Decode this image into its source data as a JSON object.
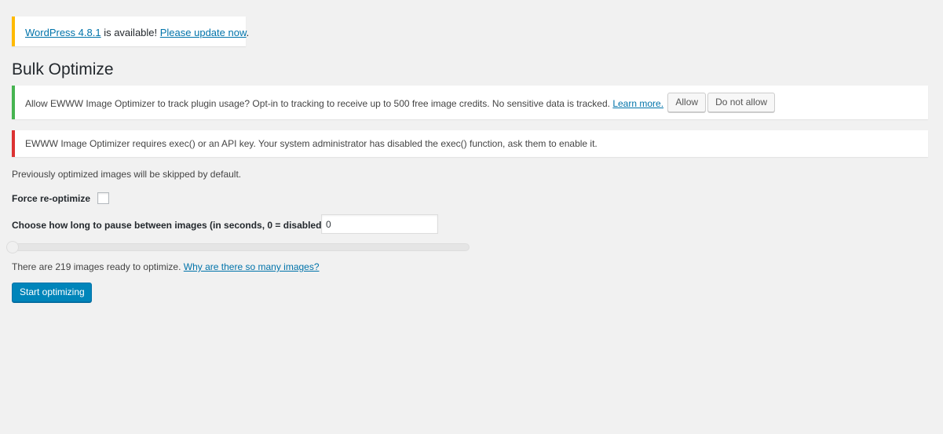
{
  "update_nag": {
    "version_link": "WordPress 4.8.1",
    "middle_text": " is available! ",
    "update_link": "Please update now",
    "end_text": "."
  },
  "page": {
    "title": "Bulk Optimize"
  },
  "tracking_notice": {
    "text": "Allow EWWW Image Optimizer to track plugin usage? Opt-in to tracking to receive up to 500 free image credits. No sensitive data is tracked. ",
    "learn_more": "Learn more.",
    "allow_label": "Allow",
    "deny_label": "Do not allow"
  },
  "error_notice": {
    "text": "EWWW Image Optimizer requires exec() or an API key. Your system administrator has disabled the exec() function, ask them to enable it."
  },
  "form": {
    "skipped_text": "Previously optimized images will be skipped by default.",
    "force_label": "Force re-optimize",
    "force_checked": false,
    "pause_label": "Choose how long to pause between images (in seconds, 0 = disabled)",
    "pause_value": "0",
    "slider_value": 0,
    "ready_text": "There are 219 images ready to optimize. ",
    "why_link": "Why are there so many images?",
    "start_label": "Start optimizing"
  }
}
